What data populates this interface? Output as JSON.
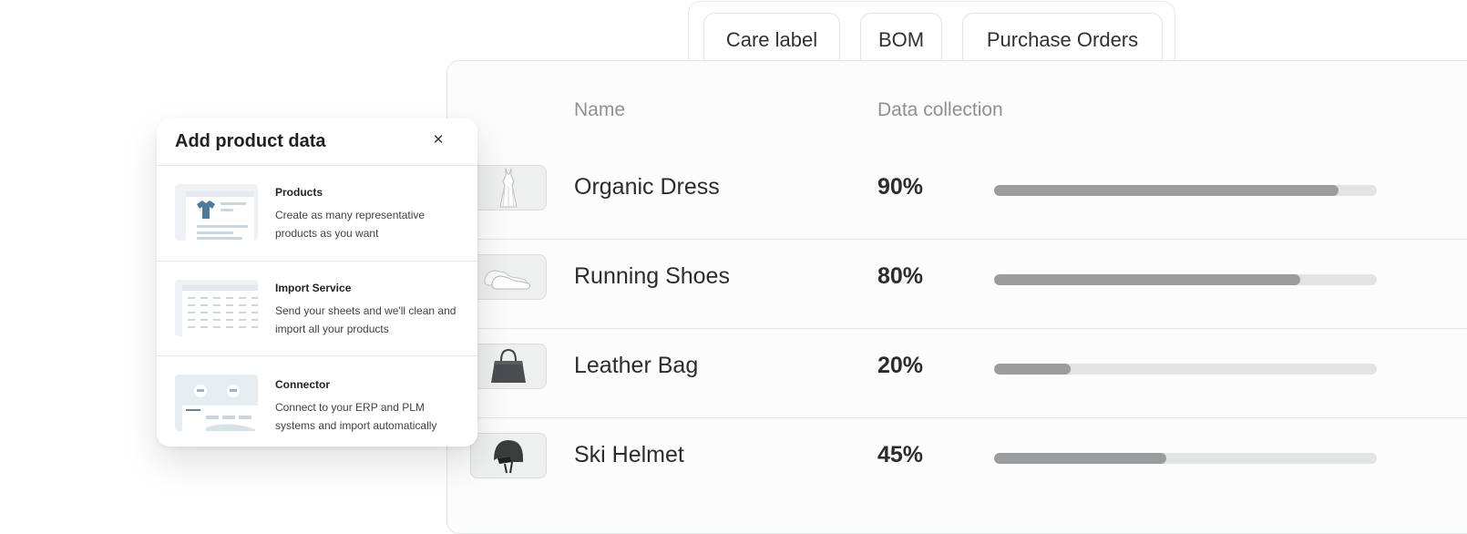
{
  "tabs": {
    "care_label": "Care label",
    "bom": "BOM",
    "purchase_orders": "Purchase Orders"
  },
  "table": {
    "headers": {
      "name": "Name",
      "collection": "Data collection"
    },
    "rows": [
      {
        "name": "Organic Dress",
        "percent_label": "90%",
        "percent": 90,
        "icon": "dress-icon"
      },
      {
        "name": "Running Shoes",
        "percent_label": "80%",
        "percent": 80,
        "icon": "shoes-icon"
      },
      {
        "name": "Leather Bag",
        "percent_label": "20%",
        "percent": 20,
        "icon": "bag-icon"
      },
      {
        "name": "Ski Helmet",
        "percent_label": "45%",
        "percent": 45,
        "icon": "helmet-icon"
      }
    ]
  },
  "modal": {
    "title": "Add product data",
    "close_icon": "close-icon",
    "options": [
      {
        "title": "Products",
        "desc": "Create as many representative products as you want",
        "icon": "tshirt-icon"
      },
      {
        "title": "Import Service",
        "desc": "Send your sheets and we'll clean and import all your products",
        "icon": "spreadsheet-icon"
      },
      {
        "title": "Connector",
        "desc": "Connect to your ERP and PLM systems and import automatically",
        "icon": "connector-icon"
      }
    ]
  },
  "colors": {
    "bar_fill": "#9a9c9d",
    "bar_track": "#e2e3e3",
    "tshirt": "#4d7a99"
  }
}
